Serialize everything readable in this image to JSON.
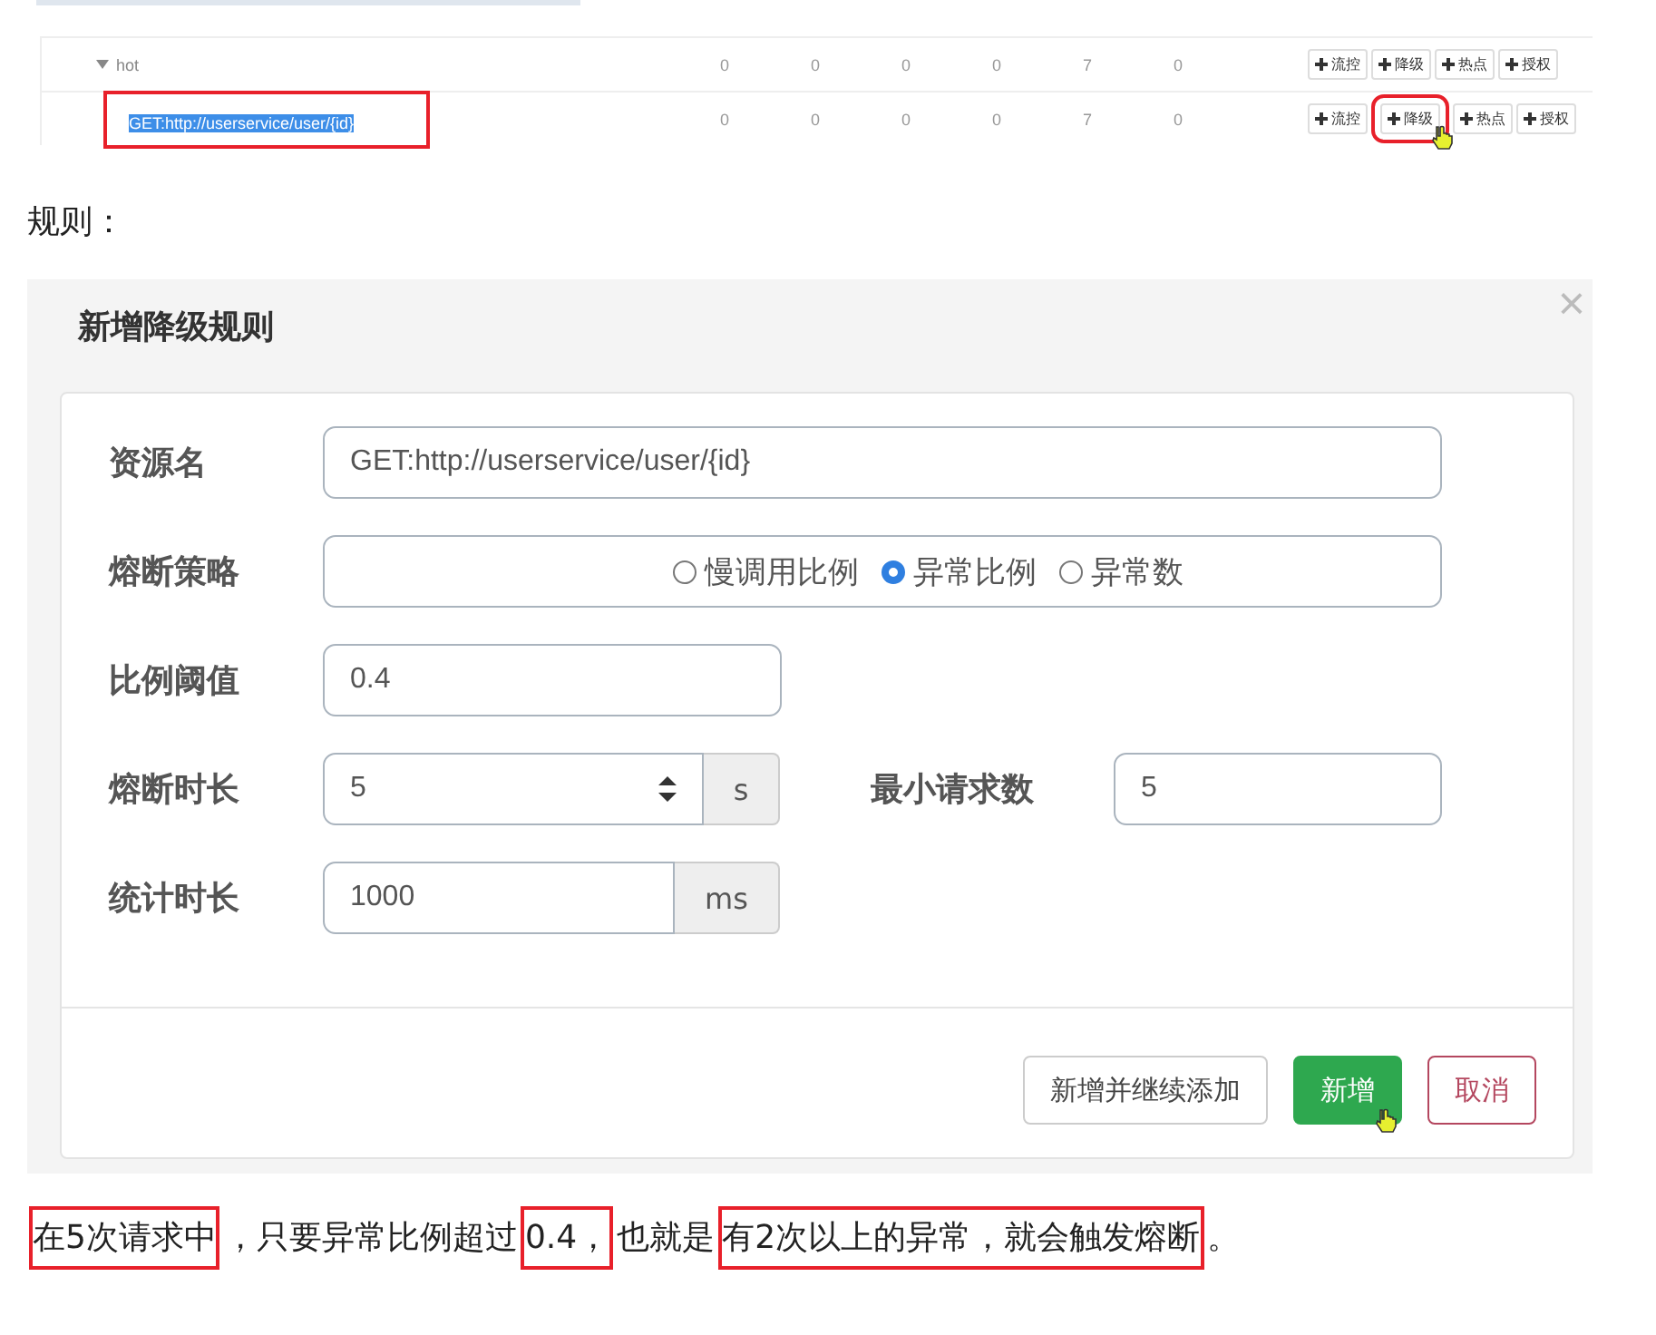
{
  "resource_table": {
    "rows": [
      {
        "name": "hot",
        "expanded": true,
        "highlighted": false,
        "values": [
          "0",
          "0",
          "0",
          "0",
          "7",
          "0"
        ],
        "actions": [
          {
            "label": "流控",
            "boxed": false,
            "hover": false
          },
          {
            "label": "降级",
            "boxed": false,
            "hover": false
          },
          {
            "label": "热点",
            "boxed": false,
            "hover": false
          },
          {
            "label": "授权",
            "boxed": false,
            "hover": false
          }
        ]
      },
      {
        "name": "GET:http://userservice/user/{id}",
        "highlighted": true,
        "values": [
          "0",
          "0",
          "0",
          "0",
          "7",
          "0"
        ],
        "actions": [
          {
            "label": "流控",
            "boxed": false,
            "hover": false
          },
          {
            "label": "降级",
            "boxed": true,
            "hover": true
          },
          {
            "label": "热点",
            "boxed": false,
            "hover": false
          },
          {
            "label": "授权",
            "boxed": false,
            "hover": false
          }
        ]
      }
    ]
  },
  "rules_heading": "规则：",
  "dialog": {
    "title": "新增降级规则",
    "close": "×",
    "resource": {
      "label": "资源名",
      "value": "GET:http://userservice/user/{id}"
    },
    "strategy": {
      "label": "熔断策略",
      "options": [
        {
          "label": "慢调用比例",
          "selected": false
        },
        {
          "label": "异常比例",
          "selected": true
        },
        {
          "label": "异常数",
          "selected": false
        }
      ]
    },
    "ratio": {
      "label": "比例阈值",
      "value": "0.4"
    },
    "duration": {
      "label": "熔断时长",
      "value": "5",
      "unit": "s"
    },
    "min_requests": {
      "label": "最小请求数",
      "value": "5"
    },
    "stat_duration": {
      "label": "统计时长",
      "value": "1000",
      "unit": "ms"
    },
    "buttons": [
      {
        "label": "新增并继续添加",
        "kind": "default",
        "hover": false
      },
      {
        "label": "新增",
        "kind": "primary",
        "hover": true
      },
      {
        "label": "取消",
        "kind": "danger",
        "hover": false
      }
    ]
  },
  "explanation": [
    {
      "text": "在5次请求中",
      "boxed": true
    },
    {
      "text": "，只要异常比例超过",
      "boxed": false
    },
    {
      "text": "0.4，",
      "boxed": true
    },
    {
      "text": "也就是",
      "boxed": false
    },
    {
      "text": "有2次以上的异常，就会触发熔断",
      "boxed": true
    },
    {
      "text": "。",
      "boxed": false
    }
  ]
}
